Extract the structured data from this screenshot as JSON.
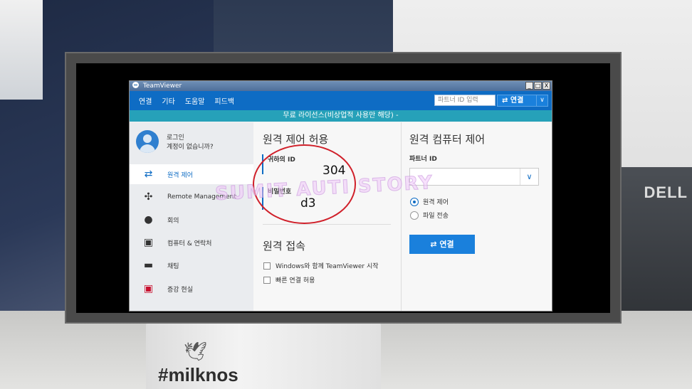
{
  "app": {
    "title": "TeamViewer",
    "window_buttons": [
      "_",
      "□",
      "X"
    ]
  },
  "menu": {
    "items": [
      "연결",
      "기타",
      "도움말",
      "피드백"
    ],
    "partner_placeholder": "파트너 ID 입력",
    "connect_label": "연결"
  },
  "banner": "무료 라이선스(비상업적 사용만 해당) -",
  "profile": {
    "line1": "로그인",
    "line2": "계정이 없습니까?"
  },
  "sidebar": {
    "items": [
      {
        "label": "원격 제어",
        "icon": "swap-arrows-icon",
        "glyph": "⇄",
        "active": true
      },
      {
        "label": "Remote Management",
        "icon": "management-icon",
        "glyph": "✣",
        "active": false
      },
      {
        "label": "회의",
        "icon": "meeting-icon",
        "glyph": "👥",
        "active": false
      },
      {
        "label": "컴퓨터 & 연락처",
        "icon": "contacts-icon",
        "glyph": "▣",
        "active": false
      },
      {
        "label": "채팅",
        "icon": "chat-icon",
        "glyph": "💬",
        "active": false
      },
      {
        "label": "증강 현실",
        "icon": "augmented-reality-icon",
        "glyph": "▣",
        "active": false
      }
    ]
  },
  "remote_allow": {
    "title": "원격 제어 허용",
    "id_label": "귀하의 ID",
    "id_value": "304",
    "password_label": "비밀번호",
    "password_value": "d3"
  },
  "remote_access": {
    "title": "원격 접속",
    "options": [
      {
        "label": "Windows와 함께 TeamViewer 시작",
        "checked": false
      },
      {
        "label": "빠른 연결 허용",
        "checked": false
      }
    ]
  },
  "remote_control": {
    "title": "원격 컴퓨터 제어",
    "partner_label": "파트너 ID",
    "partner_value": "",
    "modes": [
      {
        "label": "원격 제어",
        "selected": true
      },
      {
        "label": "파일 전송",
        "selected": false
      }
    ],
    "connect_label": "연결"
  },
  "background": {
    "brand": "DELL",
    "mug_text": "#milknos",
    "watermark": "SUMIT AUTI STORY"
  },
  "colors": {
    "accent": "#0e6cc4",
    "banner": "#26a1b9",
    "annotation_ring": "#d0202a"
  }
}
